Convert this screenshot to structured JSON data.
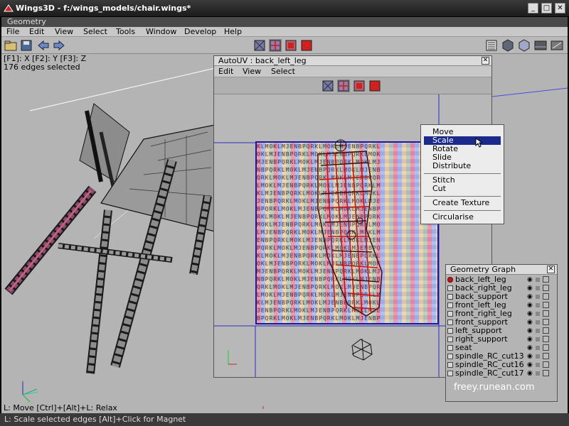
{
  "window": {
    "title": "Wings3D - f:/wings_models/chair.wings*",
    "minimize": "_",
    "maximize": "□",
    "close": "✕"
  },
  "geometry_header": "Geometry",
  "menubar": [
    "File",
    "Edit",
    "View",
    "Select",
    "Tools",
    "Window",
    "Develop",
    "Help"
  ],
  "viewport": {
    "axis_info": "[F1]: X  [F2]: Y  [F3]: Z",
    "selection_info": "176 edges selected",
    "hint": "L: Move  [Ctrl]+[Alt]+L: Relax"
  },
  "status": "L: Scale selected edges  [Alt]+Click for Magnet",
  "autouv": {
    "title": "AutoUV : back_left_leg",
    "close": "✕",
    "menu": [
      "Edit",
      "View",
      "Select"
    ]
  },
  "context_menu": {
    "items": [
      "Move",
      "Scale",
      "Rotate",
      "Slide",
      "Distribute",
      "Stitch",
      "Cut",
      "Create Texture",
      "Circularise"
    ],
    "selected": "Scale"
  },
  "geometry_graph": {
    "title": "Geometry Graph",
    "close": "✕",
    "items": [
      "back_left_leg",
      "back_right_leg",
      "back_support",
      "front_left_leg",
      "front_right_leg",
      "front_support",
      "left_support",
      "right_support",
      "seat",
      "spindle_RC_cut13",
      "spindle_RC_cut16",
      "spindle_RC_cut17"
    ],
    "selected": "back_left_leg"
  },
  "watermark": "freey.runean.com",
  "colors": {
    "selection": "#1c2a8c",
    "uv_edges": "#c01818",
    "texture_border": "#1a1aa0"
  }
}
